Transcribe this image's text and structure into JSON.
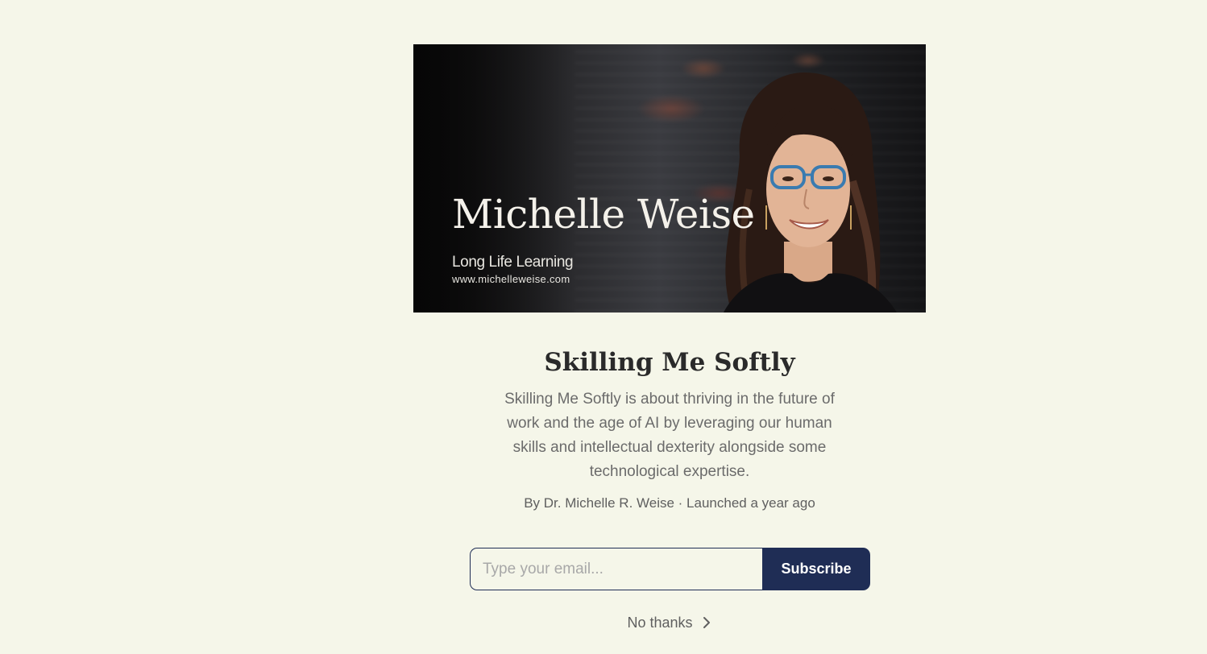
{
  "banner": {
    "name": "Michelle Weise",
    "tagline": "Long Life Learning",
    "url": "www.michelleweise.com"
  },
  "publication": {
    "title": "Skilling Me Softly",
    "description": "Skilling Me Softly is about thriving in the future of work and the age of AI by leveraging our human skills and intellectual dexterity alongside some technological expertise.",
    "byline": "By Dr. Michelle R. Weise · Launched a year ago"
  },
  "subscribe": {
    "email_placeholder": "Type your email...",
    "email_value": "",
    "button_label": "Subscribe"
  },
  "dismiss": {
    "label": "No thanks",
    "icon": "chevron-right-icon"
  },
  "colors": {
    "background": "#f5f6e9",
    "accent": "#1f2d55",
    "title": "#2a2a2a",
    "muted_text": "#6b6b6b"
  }
}
